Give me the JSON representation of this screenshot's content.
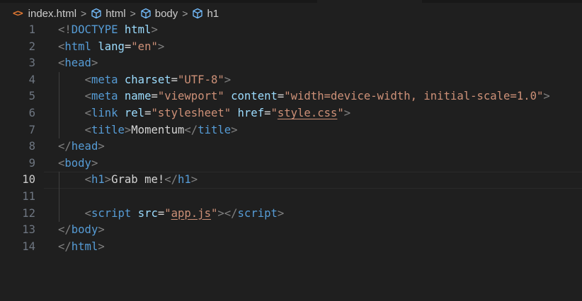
{
  "breadcrumb": {
    "file_icon": "<>",
    "file": "index.html",
    "items": [
      "html",
      "body",
      "h1"
    ],
    "sep": ">"
  },
  "editor": {
    "current_line": 10,
    "lines": [
      {
        "num": "1",
        "tokens": [
          [
            "br",
            "<!"
          ],
          [
            "tag",
            "DOCTYPE"
          ],
          [
            "txt",
            " "
          ],
          [
            "attr",
            "html"
          ],
          [
            "br",
            ">"
          ]
        ]
      },
      {
        "num": "2",
        "tokens": [
          [
            "br",
            "<"
          ],
          [
            "tag",
            "html"
          ],
          [
            "txt",
            " "
          ],
          [
            "attr",
            "lang"
          ],
          [
            "txt",
            "="
          ],
          [
            "str",
            "\"en\""
          ],
          [
            "br",
            ">"
          ]
        ]
      },
      {
        "num": "3",
        "tokens": [
          [
            "br",
            "<"
          ],
          [
            "tag",
            "head"
          ],
          [
            "br",
            ">"
          ]
        ]
      },
      {
        "num": "4",
        "tokens": [
          [
            "txt",
            "    "
          ],
          [
            "br",
            "<"
          ],
          [
            "tag",
            "meta"
          ],
          [
            "txt",
            " "
          ],
          [
            "attr",
            "charset"
          ],
          [
            "txt",
            "="
          ],
          [
            "str",
            "\"UTF-8\""
          ],
          [
            "br",
            ">"
          ]
        ]
      },
      {
        "num": "5",
        "tokens": [
          [
            "txt",
            "    "
          ],
          [
            "br",
            "<"
          ],
          [
            "tag",
            "meta"
          ],
          [
            "txt",
            " "
          ],
          [
            "attr",
            "name"
          ],
          [
            "txt",
            "="
          ],
          [
            "str",
            "\"viewport\""
          ],
          [
            "txt",
            " "
          ],
          [
            "attr",
            "content"
          ],
          [
            "txt",
            "="
          ],
          [
            "str",
            "\"width=device-width, initial-scale=1.0\""
          ],
          [
            "br",
            ">"
          ]
        ]
      },
      {
        "num": "6",
        "tokens": [
          [
            "txt",
            "    "
          ],
          [
            "br",
            "<"
          ],
          [
            "tag",
            "link"
          ],
          [
            "txt",
            " "
          ],
          [
            "attr",
            "rel"
          ],
          [
            "txt",
            "="
          ],
          [
            "str",
            "\"stylesheet\""
          ],
          [
            "txt",
            " "
          ],
          [
            "attr",
            "href"
          ],
          [
            "txt",
            "="
          ],
          [
            "str",
            "\""
          ],
          [
            "link",
            "style.css"
          ],
          [
            "str",
            "\""
          ],
          [
            "br",
            ">"
          ]
        ]
      },
      {
        "num": "7",
        "tokens": [
          [
            "txt",
            "    "
          ],
          [
            "br",
            "<"
          ],
          [
            "tag",
            "title"
          ],
          [
            "br",
            ">"
          ],
          [
            "txt",
            "Momentum"
          ],
          [
            "br",
            "</"
          ],
          [
            "tag",
            "title"
          ],
          [
            "br",
            ">"
          ]
        ]
      },
      {
        "num": "8",
        "tokens": [
          [
            "br",
            "</"
          ],
          [
            "tag",
            "head"
          ],
          [
            "br",
            ">"
          ]
        ]
      },
      {
        "num": "9",
        "tokens": [
          [
            "br",
            "<"
          ],
          [
            "tag",
            "body"
          ],
          [
            "br",
            ">"
          ]
        ]
      },
      {
        "num": "10",
        "tokens": [
          [
            "txt",
            "    "
          ],
          [
            "br",
            "<"
          ],
          [
            "tag",
            "h1"
          ],
          [
            "br",
            ">"
          ],
          [
            "txt",
            "Grab me!"
          ],
          [
            "br",
            "</"
          ],
          [
            "tag",
            "h1"
          ],
          [
            "br",
            ">"
          ]
        ]
      },
      {
        "num": "11",
        "tokens": []
      },
      {
        "num": "12",
        "tokens": [
          [
            "txt",
            "    "
          ],
          [
            "br",
            "<"
          ],
          [
            "tag",
            "script"
          ],
          [
            "txt",
            " "
          ],
          [
            "attr",
            "src"
          ],
          [
            "txt",
            "="
          ],
          [
            "str",
            "\""
          ],
          [
            "link",
            "app.js"
          ],
          [
            "str",
            "\""
          ],
          [
            "br",
            "></"
          ],
          [
            "tag",
            "script"
          ],
          [
            "br",
            ">"
          ]
        ]
      },
      {
        "num": "13",
        "tokens": [
          [
            "br",
            "</"
          ],
          [
            "tag",
            "body"
          ],
          [
            "br",
            ">"
          ]
        ]
      },
      {
        "num": "14",
        "tokens": [
          [
            "br",
            "</"
          ],
          [
            "tag",
            "html"
          ],
          [
            "br",
            ">"
          ]
        ]
      }
    ]
  },
  "colors": {
    "background": "#1f1f1f",
    "tag": "#569cd6",
    "attribute": "#9cdcfe",
    "string": "#ce9178",
    "bracket": "#808080",
    "text": "#d4d4d4",
    "file_icon": "#e37933"
  }
}
